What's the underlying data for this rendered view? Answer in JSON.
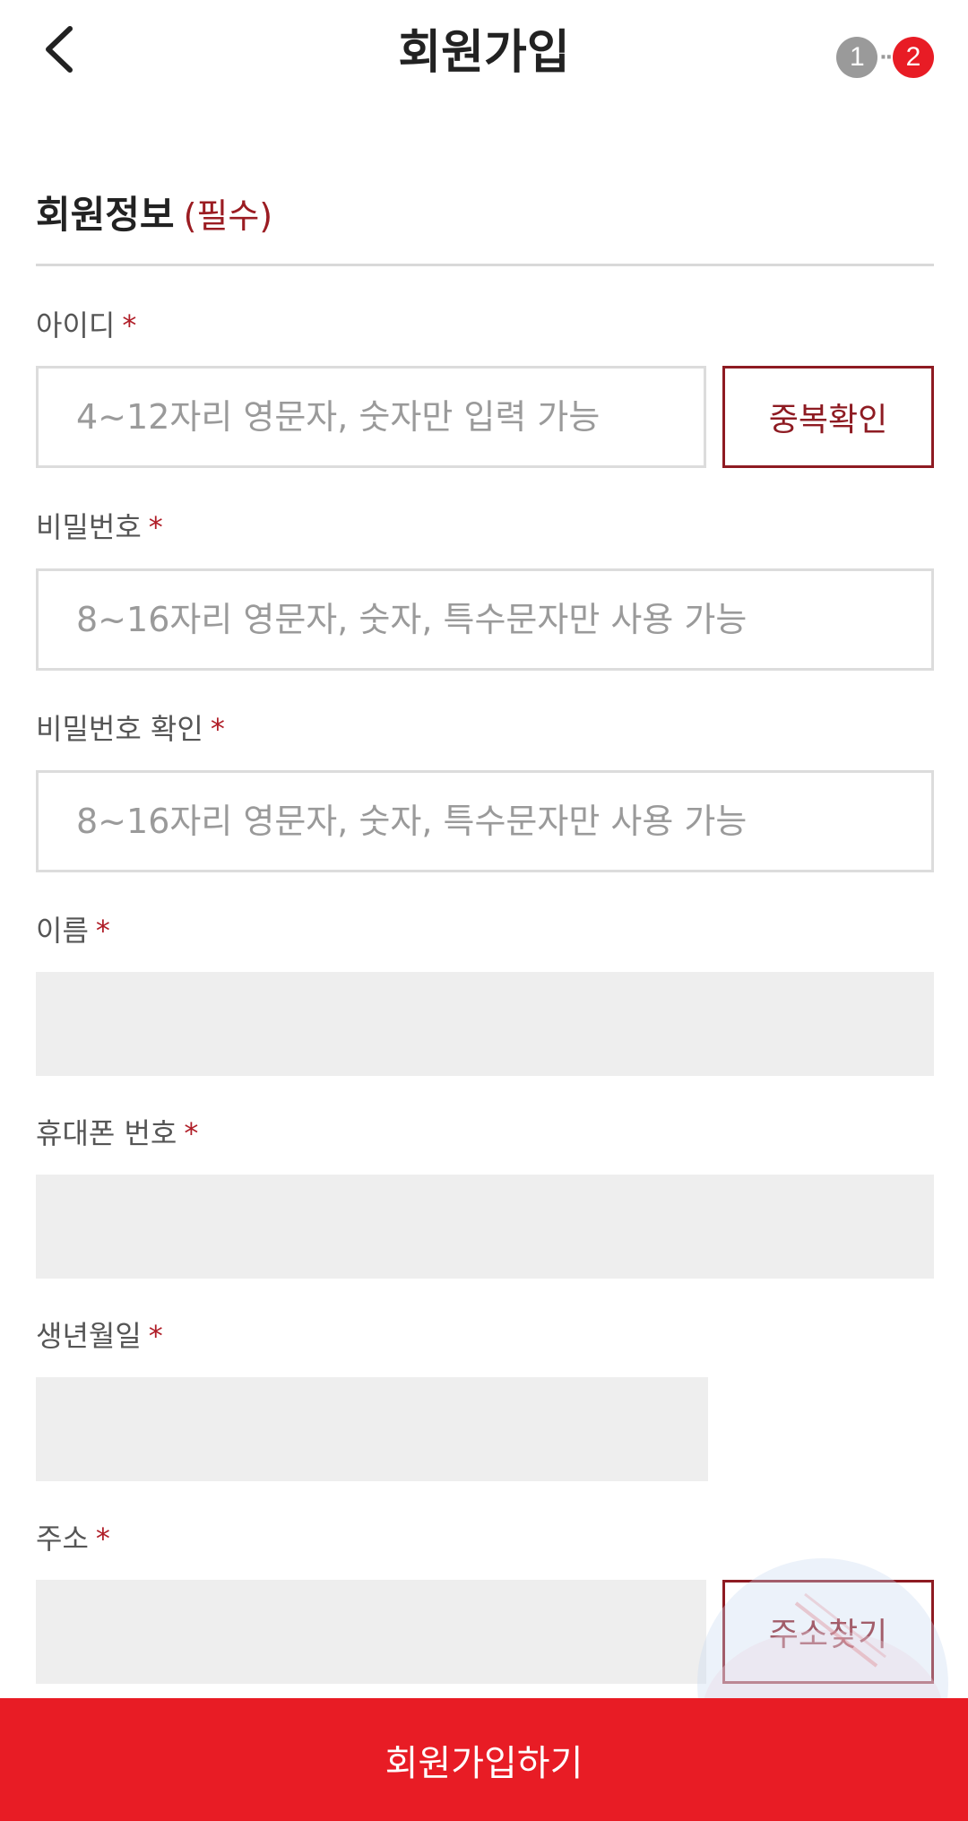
{
  "header": {
    "back_icon": "chevron-left-icon",
    "title": "회원가입",
    "steps": [
      "1",
      "2"
    ],
    "current_step": "2"
  },
  "section": {
    "title": "회원정보",
    "required_note": "(필수)"
  },
  "fields": {
    "id": {
      "label": "아이디",
      "required_mark": "*",
      "placeholder": "4~12자리 영문자, 숫자만 입력 가능",
      "value": "",
      "check_button": "중복확인"
    },
    "password": {
      "label": "비밀번호",
      "required_mark": "*",
      "placeholder": "8~16자리 영문자, 숫자, 특수문자만 사용 가능",
      "value": ""
    },
    "password_confirm": {
      "label": "비밀번호 확인",
      "required_mark": "*",
      "placeholder": "8~16자리 영문자, 숫자, 특수문자만 사용 가능",
      "value": ""
    },
    "name": {
      "label": "이름",
      "required_mark": "*",
      "value": ""
    },
    "phone": {
      "label": "휴대폰 번호",
      "required_mark": "*",
      "value": ""
    },
    "birthdate": {
      "label": "생년월일",
      "required_mark": "*",
      "value": ""
    },
    "address": {
      "label": "주소",
      "required_mark": "*",
      "value": "",
      "search_button": "주소찾기"
    }
  },
  "submit": {
    "label": "회원가입하기"
  },
  "colors": {
    "accent_red": "#e81c25",
    "dark_red": "#8e1b22",
    "step_inactive": "#9a9a9a",
    "disabled_field": "#eeeeee"
  }
}
